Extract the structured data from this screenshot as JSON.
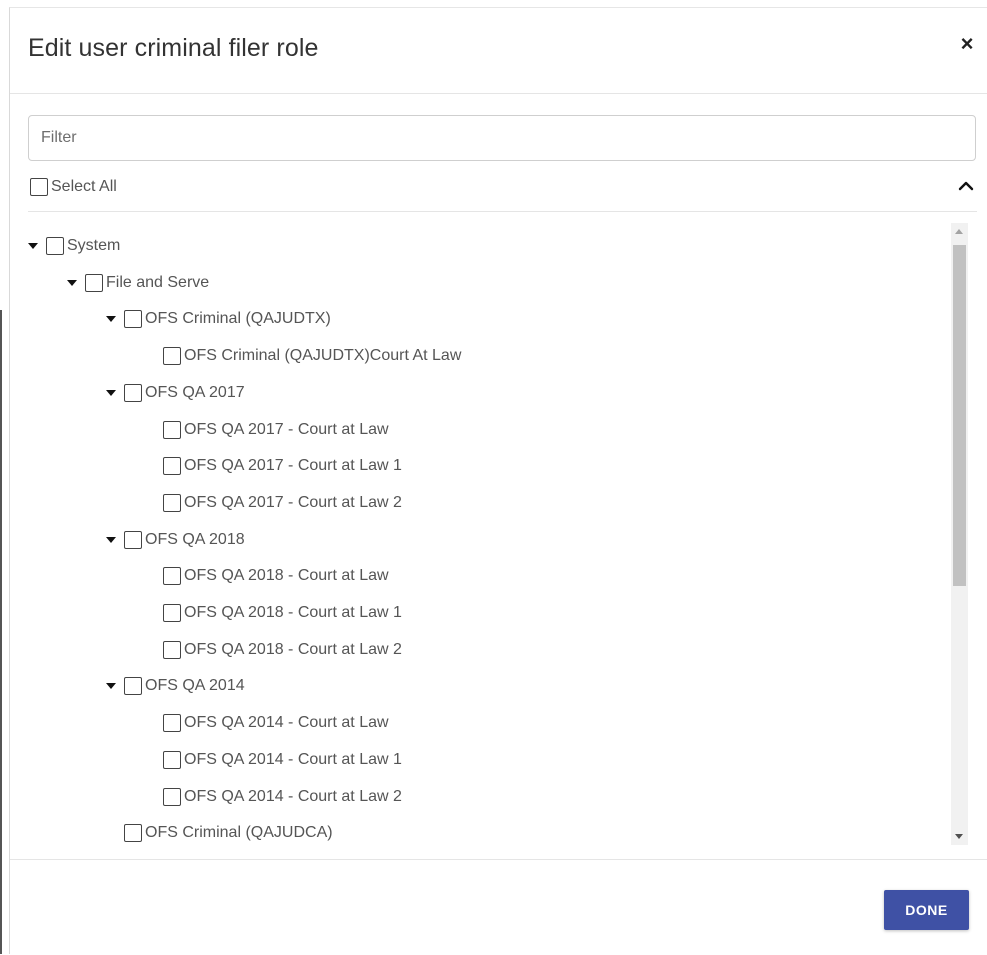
{
  "dialog": {
    "title": "Edit user criminal filer role",
    "close_symbol": "×"
  },
  "filter": {
    "placeholder": "Filter",
    "value": ""
  },
  "select_all": {
    "label": "Select All",
    "checked": false
  },
  "tree": {
    "items": [
      {
        "label": "System",
        "level": 0,
        "expanded": true,
        "checked": false
      },
      {
        "label": "File and Serve",
        "level": 1,
        "expanded": true,
        "checked": false
      },
      {
        "label": "OFS Criminal (QAJUDTX)",
        "level": 2,
        "expanded": true,
        "checked": false
      },
      {
        "label": "OFS Criminal (QAJUDTX)Court At Law",
        "level": 3,
        "expanded": null,
        "checked": false
      },
      {
        "label": "OFS QA 2017",
        "level": 2,
        "expanded": true,
        "checked": false
      },
      {
        "label": "OFS QA 2017 - Court at Law",
        "level": 3,
        "expanded": null,
        "checked": false
      },
      {
        "label": "OFS QA 2017 - Court at Law 1",
        "level": 3,
        "expanded": null,
        "checked": false
      },
      {
        "label": "OFS QA 2017 - Court at Law 2",
        "level": 3,
        "expanded": null,
        "checked": false
      },
      {
        "label": "OFS QA 2018",
        "level": 2,
        "expanded": true,
        "checked": false
      },
      {
        "label": "OFS QA 2018 - Court at Law",
        "level": 3,
        "expanded": null,
        "checked": false
      },
      {
        "label": "OFS QA 2018 - Court at Law 1",
        "level": 3,
        "expanded": null,
        "checked": false
      },
      {
        "label": "OFS QA 2018 - Court at Law 2",
        "level": 3,
        "expanded": null,
        "checked": false
      },
      {
        "label": "OFS QA 2014",
        "level": 2,
        "expanded": true,
        "checked": false
      },
      {
        "label": "OFS QA 2014 - Court at Law",
        "level": 3,
        "expanded": null,
        "checked": false
      },
      {
        "label": "OFS QA 2014 - Court at Law 1",
        "level": 3,
        "expanded": null,
        "checked": false
      },
      {
        "label": "OFS QA 2014 - Court at Law 2",
        "level": 3,
        "expanded": null,
        "checked": false
      },
      {
        "label": "OFS Criminal (QAJUDCA)",
        "level": 2,
        "expanded": null,
        "checked": false
      }
    ]
  },
  "footer": {
    "done_label": "DONE"
  },
  "colors": {
    "primary_button": "#3f51a5",
    "text": "#555555",
    "border": "#cfcfcf"
  },
  "icons": {
    "close": "close-icon",
    "collapse": "chevron-up-icon",
    "expand_caret": "caret-down-icon",
    "checkbox": "checkbox-icon",
    "scroll_up": "scroll-up-arrow-icon",
    "scroll_down": "scroll-down-arrow-icon"
  }
}
